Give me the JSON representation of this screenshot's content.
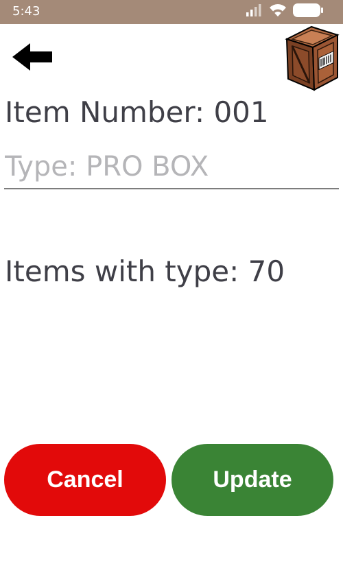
{
  "status_bar": {
    "time": "5:43",
    "background_color": "#a48a78",
    "icons": [
      "signal-icon",
      "wifi-icon",
      "battery-icon"
    ]
  },
  "header": {
    "back_icon": "arrow-left-icon",
    "logo_icon": "wooden-crate-icon"
  },
  "item": {
    "number_text": "Item Number: 001",
    "type_placeholder": "Type: PRO BOX",
    "type_value": "",
    "items_with_type_text": "Items with type: 70"
  },
  "actions": {
    "cancel_label": "Cancel",
    "cancel_color": "#e20a0a",
    "update_label": "Update",
    "update_color": "#3a8435"
  }
}
